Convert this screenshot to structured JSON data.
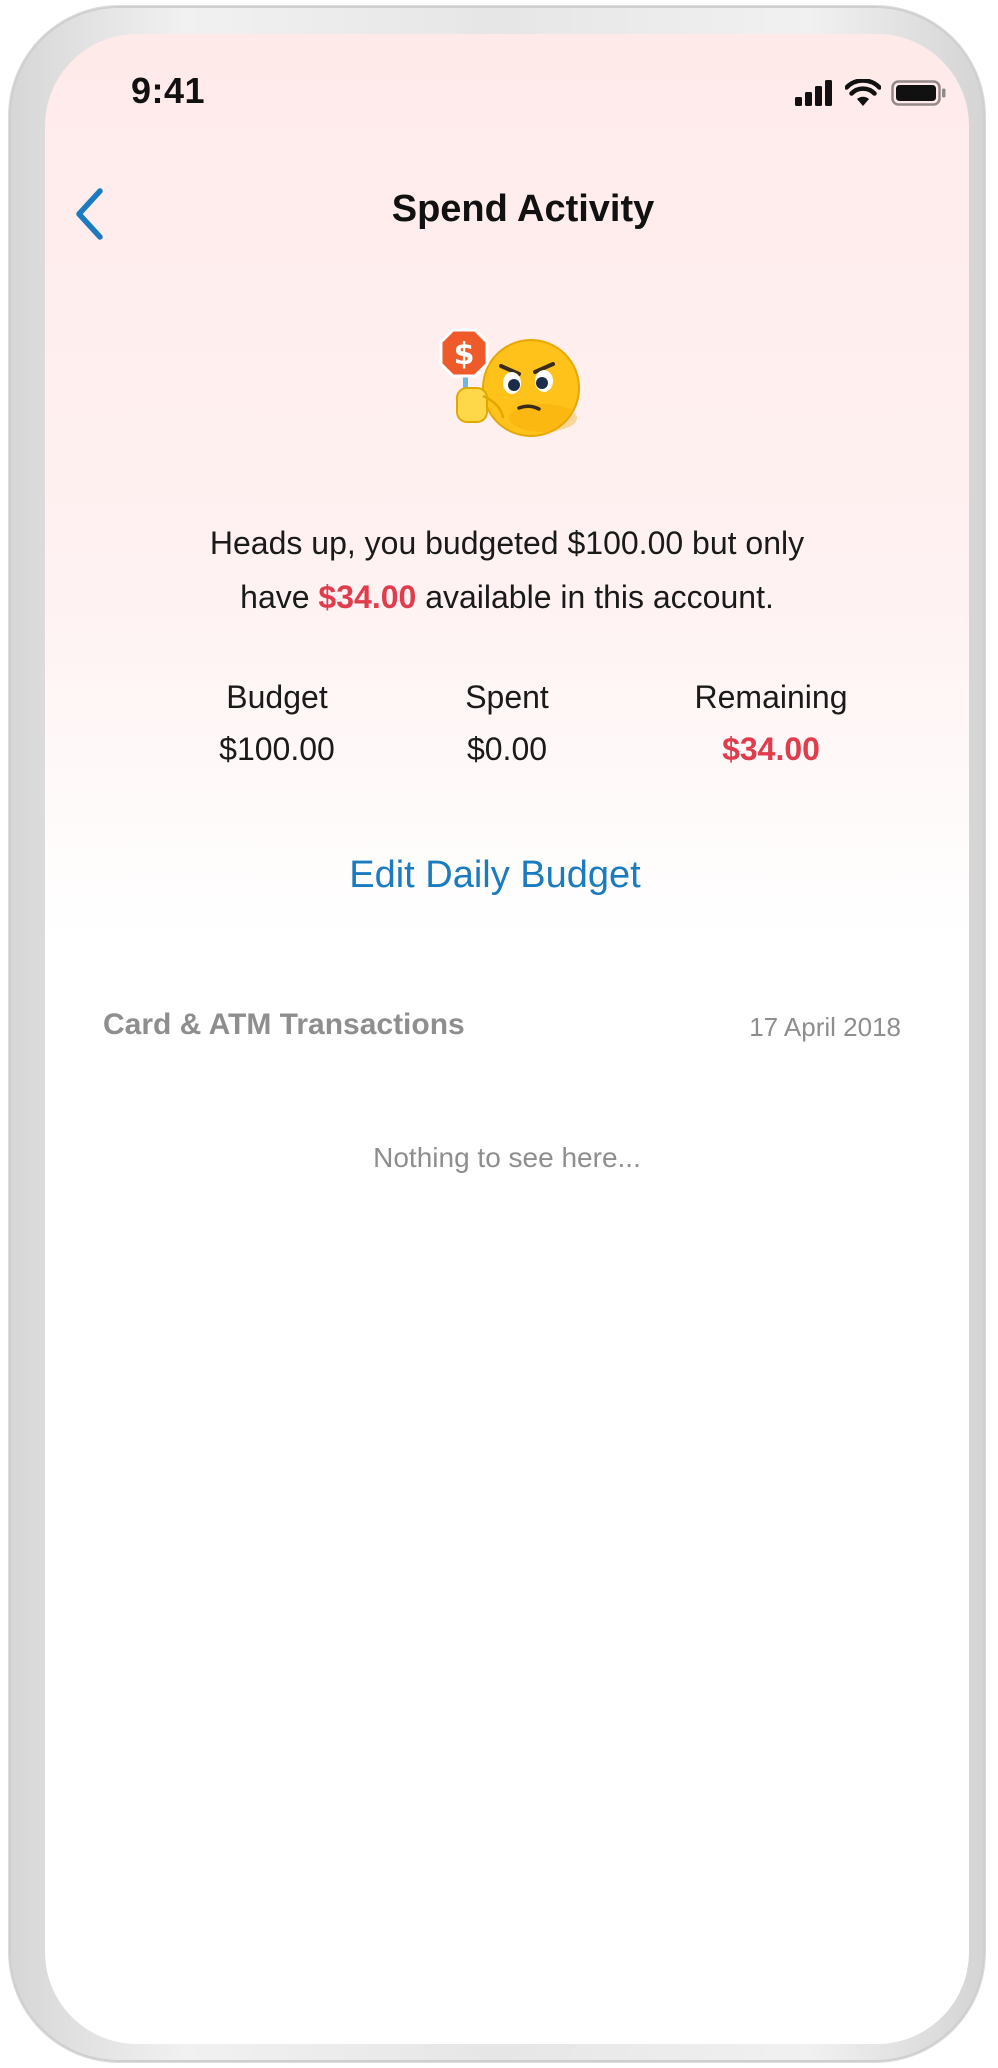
{
  "status_bar": {
    "time": "9:41"
  },
  "nav": {
    "title": "Spend Activity"
  },
  "alert": {
    "text_before": "Heads up, you budgeted $100.00 but only",
    "text_have": "have ",
    "amount": "$34.00",
    "text_after": " available in this account."
  },
  "stats": {
    "budget_label": "Budget",
    "budget_value": "$100.00",
    "spent_label": "Spent",
    "spent_value": "$0.00",
    "remaining_label": "Remaining",
    "remaining_value": "$34.00"
  },
  "edit_budget_label": "Edit Daily Budget",
  "transactions": {
    "section_title": "Card & ATM Transactions",
    "date": "17 April 2018",
    "empty_text": "Nothing to see here..."
  },
  "colors": {
    "accent": "#1a7bbf",
    "warning_red": "#e03c4c",
    "secondary_text": "#8e8e8e"
  },
  "icons": [
    "signal-icon",
    "wifi-icon",
    "battery-icon",
    "back-chevron-icon",
    "stop-sign-emoji-icon"
  ]
}
